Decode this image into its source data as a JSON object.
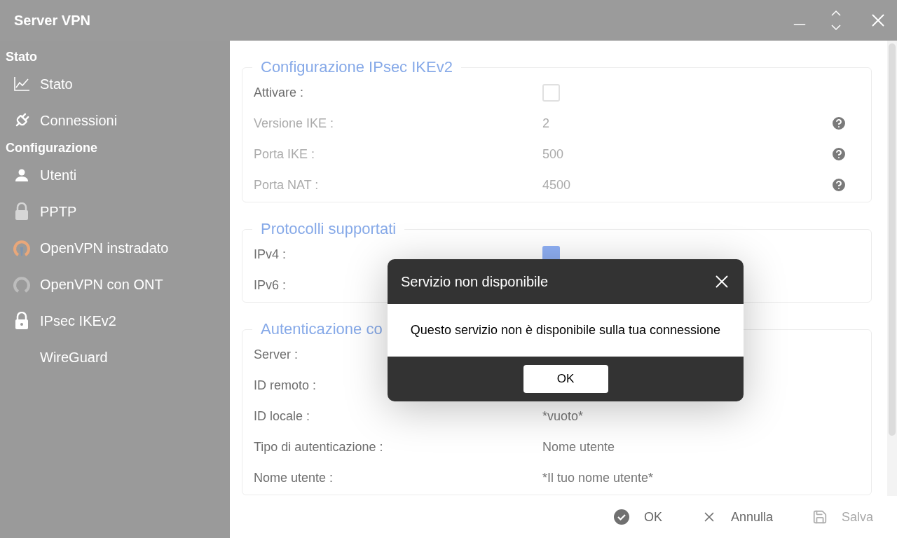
{
  "window": {
    "title": "Server VPN"
  },
  "sidebar": [
    {
      "title": "Stato",
      "items": [
        {
          "label": "Stato"
        },
        {
          "label": "Connessioni"
        }
      ]
    },
    {
      "title": "Configurazione",
      "items": [
        {
          "label": "Utenti"
        },
        {
          "label": "PPTP"
        },
        {
          "label": "OpenVPN instradato"
        },
        {
          "label": "OpenVPN con ONT"
        },
        {
          "label": "IPsec IKEv2"
        },
        {
          "label": "WireGuard"
        }
      ]
    }
  ],
  "sections": [
    {
      "legend": "Configurazione IPsec IKEv2",
      "rows": [
        {
          "label": "Attivare :",
          "kind": "checkbox",
          "checked": false,
          "disabled": false,
          "help": false
        },
        {
          "label": "Versione IKE :",
          "kind": "text",
          "value": "2",
          "disabled": true,
          "help": true
        },
        {
          "label": "Porta IKE :",
          "kind": "text",
          "value": "500",
          "disabled": true,
          "help": true
        },
        {
          "label": "Porta NAT :",
          "kind": "text",
          "value": "4500",
          "disabled": true,
          "help": true
        }
      ]
    },
    {
      "legend": "Protocolli supportati",
      "rows": [
        {
          "label": "IPv4 :",
          "kind": "checkbox",
          "checked": true,
          "disabled": false,
          "help": false
        },
        {
          "label": "IPv6 :",
          "kind": "text",
          "disabled": false,
          "help": false
        }
      ]
    },
    {
      "legend": "Autenticazione co",
      "rows": [
        {
          "label": "Server :",
          "kind": "text",
          "disabled": false,
          "help": false
        },
        {
          "label": "ID remoto :",
          "kind": "text",
          "disabled": false,
          "help": false
        },
        {
          "label": "ID locale :",
          "kind": "text",
          "value": "*vuoto*",
          "disabled": false,
          "help": false
        },
        {
          "label": "Tipo di autenticazione :",
          "kind": "text",
          "value": "Nome utente",
          "disabled": false,
          "help": false
        },
        {
          "label": "Nome utente :",
          "kind": "text",
          "value": "*Il tuo nome utente*",
          "disabled": false,
          "help": false
        }
      ]
    }
  ],
  "footer": [
    {
      "label": "OK",
      "disabled": false
    },
    {
      "label": "Annulla",
      "disabled": false
    },
    {
      "label": "Salva",
      "disabled": true
    }
  ],
  "dialog": {
    "title": "Servizio non disponibile",
    "message": "Questo servizio non è disponibile sulla tua connessione",
    "button": "OK"
  }
}
